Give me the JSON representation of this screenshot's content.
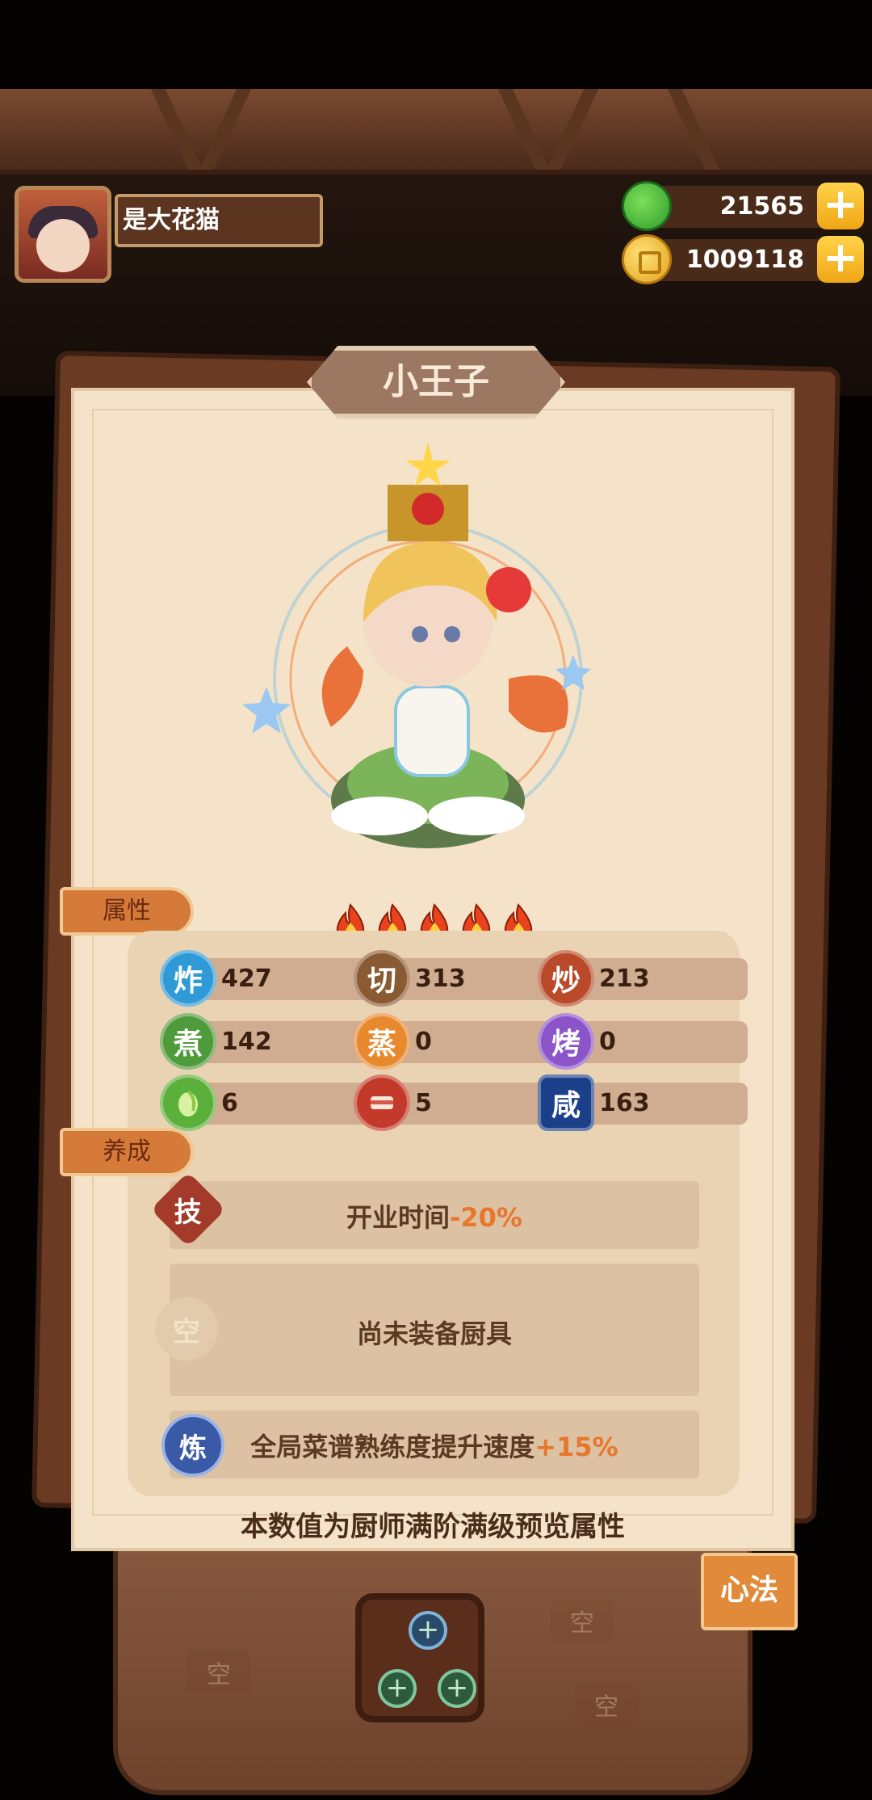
{
  "player": {
    "name": "是大花猫"
  },
  "currency": {
    "jade": "21565",
    "coins": "1009118",
    "plus": "+"
  },
  "chef": {
    "name": "小王子",
    "rarity_flames": 5
  },
  "tabs": {
    "attributes": "属性",
    "cultivate": "养成"
  },
  "stats": [
    {
      "label": "炸",
      "value": "427",
      "color": "#2f9ad6"
    },
    {
      "label": "切",
      "value": "313",
      "color": "#8a5a32"
    },
    {
      "label": "炒",
      "value": "213",
      "color": "#b84a2a"
    },
    {
      "label": "煮",
      "value": "142",
      "color": "#4f9a3a"
    },
    {
      "label": "蒸",
      "value": "0",
      "color": "#e8892e"
    },
    {
      "label": "烤",
      "value": "0",
      "color": "#8b55c9"
    },
    {
      "label": "vegetable-icon",
      "value": "6",
      "color": "#5ab03a"
    },
    {
      "label": "meat-icon",
      "value": "5",
      "color": "#c43a2a"
    },
    {
      "label": "咸",
      "value": "163",
      "color": "#1c3f8a"
    }
  ],
  "cultivate": {
    "skill": {
      "badge": "技",
      "text": "开业时间",
      "highlight": "-20%"
    },
    "equip": {
      "badge": "空",
      "text": "尚未装备厨具"
    },
    "refine": {
      "badge": "炼",
      "text": "全局菜谱熟练度提升速度",
      "highlight": "+15%"
    }
  },
  "footer_note": "本数值为厨师满阶满级预览属性",
  "xinfa": {
    "label": "心法"
  },
  "skill_tree": {
    "empty_label": "空"
  }
}
